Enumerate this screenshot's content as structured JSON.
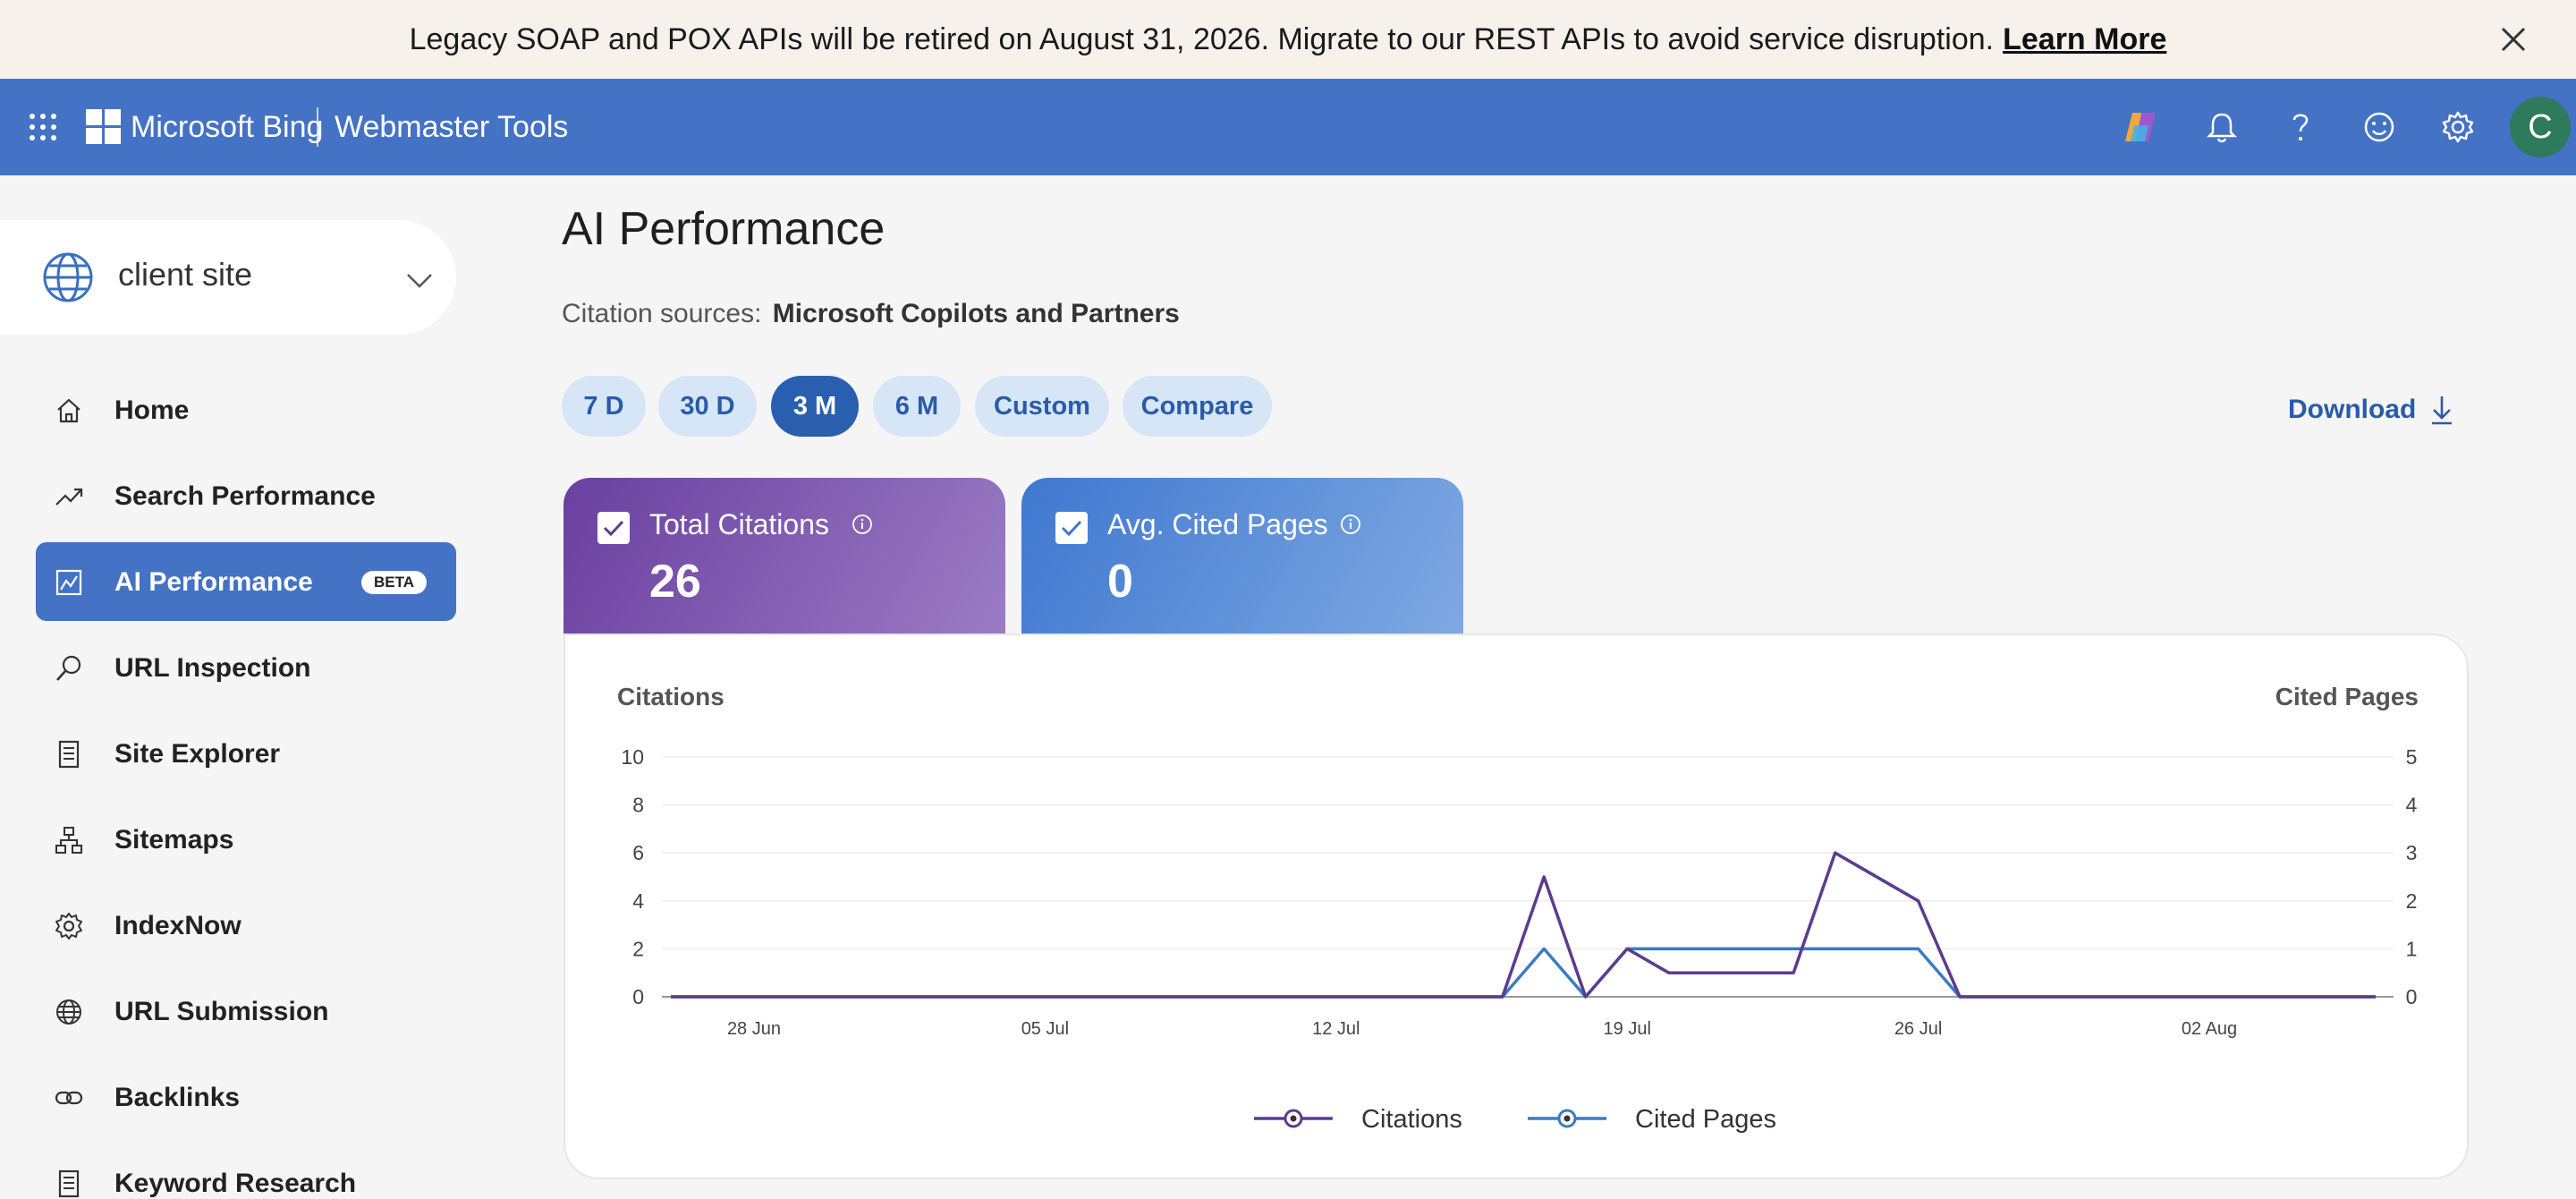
{
  "banner": {
    "message": "Legacy SOAP and POX APIs will be retired on August 31, 2026. Migrate to our REST APIs to avoid service disruption.",
    "link_label": "Learn More",
    "close_icon": "close-icon"
  },
  "topnav": {
    "brand": "Microsoft Bing",
    "product": "Webmaster Tools",
    "avatar_letter": "C",
    "icons": [
      "app-launcher-icon",
      "copilot-icon",
      "bell-icon",
      "help-icon",
      "smiley-icon",
      "gear-icon"
    ]
  },
  "site_picker": {
    "label": "client site"
  },
  "sidebar": {
    "items": [
      {
        "label": "Home",
        "icon": "home-icon"
      },
      {
        "label": "Search Performance",
        "icon": "trend-icon"
      },
      {
        "label": "AI Performance",
        "icon": "ai-chart-icon",
        "badge": "BETA",
        "active": true
      },
      {
        "label": "URL Inspection",
        "icon": "magnifier-icon"
      },
      {
        "label": "Site Explorer",
        "icon": "document-icon"
      },
      {
        "label": "Sitemaps",
        "icon": "sitemap-icon"
      },
      {
        "label": "IndexNow",
        "icon": "gear-icon"
      },
      {
        "label": "URL Submission",
        "icon": "globe-icon"
      },
      {
        "label": "Backlinks",
        "icon": "link-icon"
      },
      {
        "label": "Keyword Research",
        "icon": "document-icon"
      }
    ]
  },
  "main": {
    "title": "AI Performance",
    "citation_label": "Citation sources:",
    "citation_value": "Microsoft Copilots and Partners",
    "ranges": [
      {
        "label": "7 D"
      },
      {
        "label": "30 D"
      },
      {
        "label": "3 M",
        "active": true
      },
      {
        "label": "6 M"
      },
      {
        "label": "Custom"
      },
      {
        "label": "Compare"
      }
    ],
    "download_label": "Download",
    "metrics": [
      {
        "name": "Total Citations",
        "value": "26",
        "color": "#6a3fa0"
      },
      {
        "name": "Avg. Cited Pages",
        "value": "0",
        "color": "#3f78d0"
      }
    ]
  },
  "chart_data": {
    "type": "line",
    "ylabel_left": "Citations",
    "ylabel_right": "Cited Pages",
    "y_left_ticks": [
      "0",
      "2",
      "4",
      "6",
      "8",
      "10"
    ],
    "y_right_ticks": [
      "0",
      "1",
      "2",
      "3",
      "4",
      "5"
    ],
    "ylim_left": [
      0,
      10
    ],
    "ylim_right": [
      0,
      5
    ],
    "x_tick_labels": [
      "28 Jun",
      "05 Jul",
      "12 Jul",
      "19 Jul",
      "26 Jul",
      "02 Aug"
    ],
    "x_range": [
      "2025-06-26",
      "2025-08-06"
    ],
    "series": [
      {
        "name": "Citations",
        "axis": "left",
        "color": "#5b3c8f",
        "points": [
          [
            "2025-06-26",
            0
          ],
          [
            "2025-07-16",
            0
          ],
          [
            "2025-07-17",
            5
          ],
          [
            "2025-07-18",
            0
          ],
          [
            "2025-07-19",
            2
          ],
          [
            "2025-07-20",
            1
          ],
          [
            "2025-07-23",
            1
          ],
          [
            "2025-07-24",
            6
          ],
          [
            "2025-07-26",
            4
          ],
          [
            "2025-07-27",
            0
          ],
          [
            "2025-08-06",
            0
          ]
        ]
      },
      {
        "name": "Cited Pages",
        "axis": "right",
        "color": "#3b7bc4",
        "points": [
          [
            "2025-06-26",
            0
          ],
          [
            "2025-07-16",
            0
          ],
          [
            "2025-07-17",
            1
          ],
          [
            "2025-07-18",
            0
          ],
          [
            "2025-07-19",
            1
          ],
          [
            "2025-07-26",
            1
          ],
          [
            "2025-07-27",
            0
          ],
          [
            "2025-08-06",
            0
          ]
        ]
      }
    ],
    "grid": true,
    "legend": "bottom-center"
  }
}
